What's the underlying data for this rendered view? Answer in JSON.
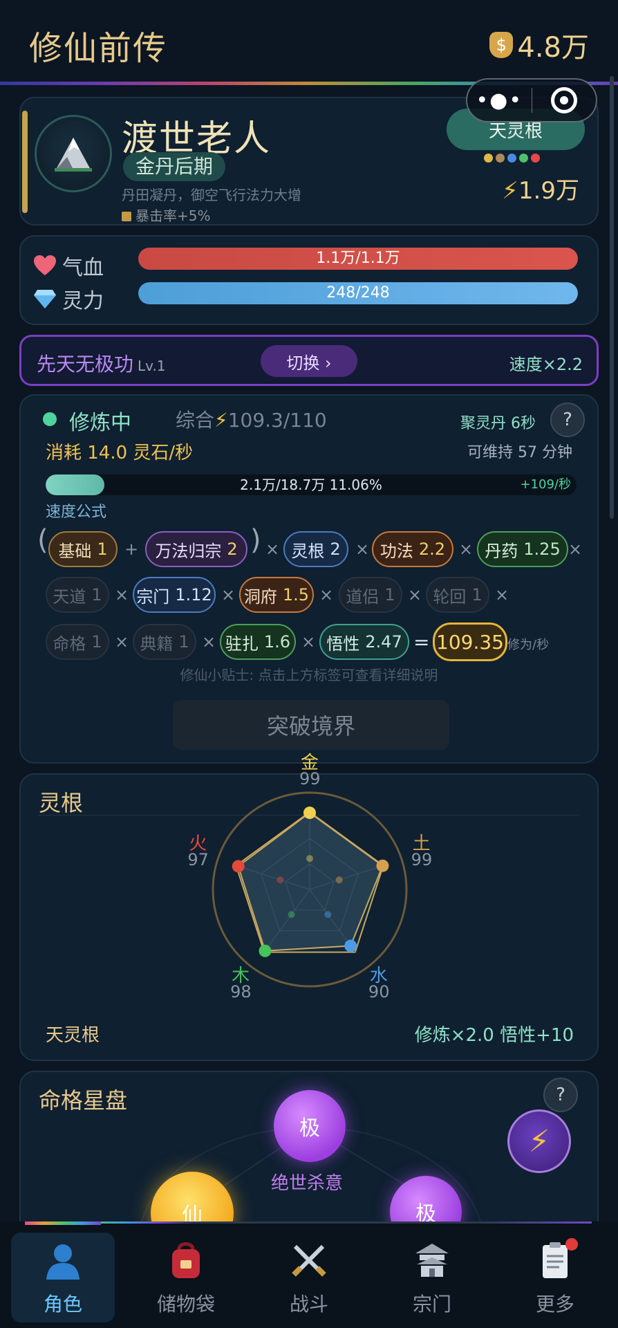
{
  "header": {
    "title": "修仙前传",
    "currency": "4.8万"
  },
  "profile": {
    "name": "渡世老人",
    "realm": "金丹后期",
    "realm_desc": "丹田凝丹，御空飞行法力大增",
    "bonus": "暴击率+5%",
    "root_button": "天灵根",
    "root_colors": [
      "#e0b84a",
      "#b08a5a",
      "#4a8be0",
      "#4fc06a",
      "#e24a4a"
    ],
    "power": "1.9万"
  },
  "stats": {
    "hp_label": "气血",
    "hp_value": "1.1万/1.1万",
    "hp_fill": 1.0,
    "mp_label": "灵力",
    "mp_value": "248/248",
    "mp_fill": 1.0
  },
  "technique": {
    "name": "先天无极功",
    "level": "Lv.1",
    "switch_label": "切换 ›",
    "speed": "速度×2.2"
  },
  "cultivation": {
    "status": "修炼中",
    "score_prefix": "综合",
    "score": "109.3/110",
    "pill_timer": "聚灵丹 6秒",
    "help": "?",
    "consume": "消耗 14.0 灵石/秒",
    "maintain": "可维持 57 分钟",
    "progress_text": "2.1万/18.7万  11.06%",
    "progress_fraction": 0.1106,
    "progress_rate": "+109/秒",
    "formula_label": "速度公式",
    "chips": {
      "basic": {
        "name": "基础",
        "val": "1"
      },
      "wanfa": {
        "name": "万法归宗",
        "val": "2"
      },
      "root": {
        "name": "灵根",
        "val": "2"
      },
      "gongfa": {
        "name": "功法",
        "val": "2.2"
      },
      "danyao": {
        "name": "丹药",
        "val": "1.25"
      },
      "tiandao": {
        "name": "天道",
        "val": "1"
      },
      "zongmen": {
        "name": "宗门",
        "val": "1.12"
      },
      "dongfu": {
        "name": "洞府",
        "val": "1.5"
      },
      "daolv": {
        "name": "道侣",
        "val": "1"
      },
      "lunhui": {
        "name": "轮回",
        "val": "1"
      },
      "mingge": {
        "name": "命格",
        "val": "1"
      },
      "dianji": {
        "name": "典籍",
        "val": "1"
      },
      "zhuzha": {
        "name": "驻扎",
        "val": "1.6"
      },
      "wuxing": {
        "name": "悟性",
        "val": "2.47"
      }
    },
    "result": "109.35",
    "result_unit": "修为/秒",
    "ops": {
      "plus": "+",
      "times": "×",
      "equals": "=",
      "lparen": "(",
      "rparen": ")"
    },
    "tip": "修仙小贴士: 点击上方标签可查看详细说明",
    "breakthrough": "突破境界"
  },
  "roots": {
    "title": "灵根",
    "elements": [
      {
        "name": "金",
        "value": 99,
        "color": "#f0d050"
      },
      {
        "name": "土",
        "value": 99,
        "color": "#d7a050"
      },
      {
        "name": "水",
        "value": 90,
        "color": "#4a9be8"
      },
      {
        "name": "木",
        "value": 98,
        "color": "#45c45a"
      },
      {
        "name": "火",
        "value": 97,
        "color": "#e24a3a"
      }
    ],
    "root_name": "天灵根",
    "effect": "修炼×2.0  悟性+10"
  },
  "destiny": {
    "title": "命格星盘",
    "help": "?",
    "top_orb": "极",
    "top_label": "绝世杀意",
    "left_orb": "仙",
    "right_orb": "极"
  },
  "nav": {
    "items": [
      {
        "label": "角色",
        "icon": "person-icon"
      },
      {
        "label": "储物袋",
        "icon": "backpack-icon"
      },
      {
        "label": "战斗",
        "icon": "swords-icon"
      },
      {
        "label": "宗门",
        "icon": "temple-icon"
      },
      {
        "label": "更多",
        "icon": "clipboard-icon"
      }
    ],
    "active": 0
  }
}
